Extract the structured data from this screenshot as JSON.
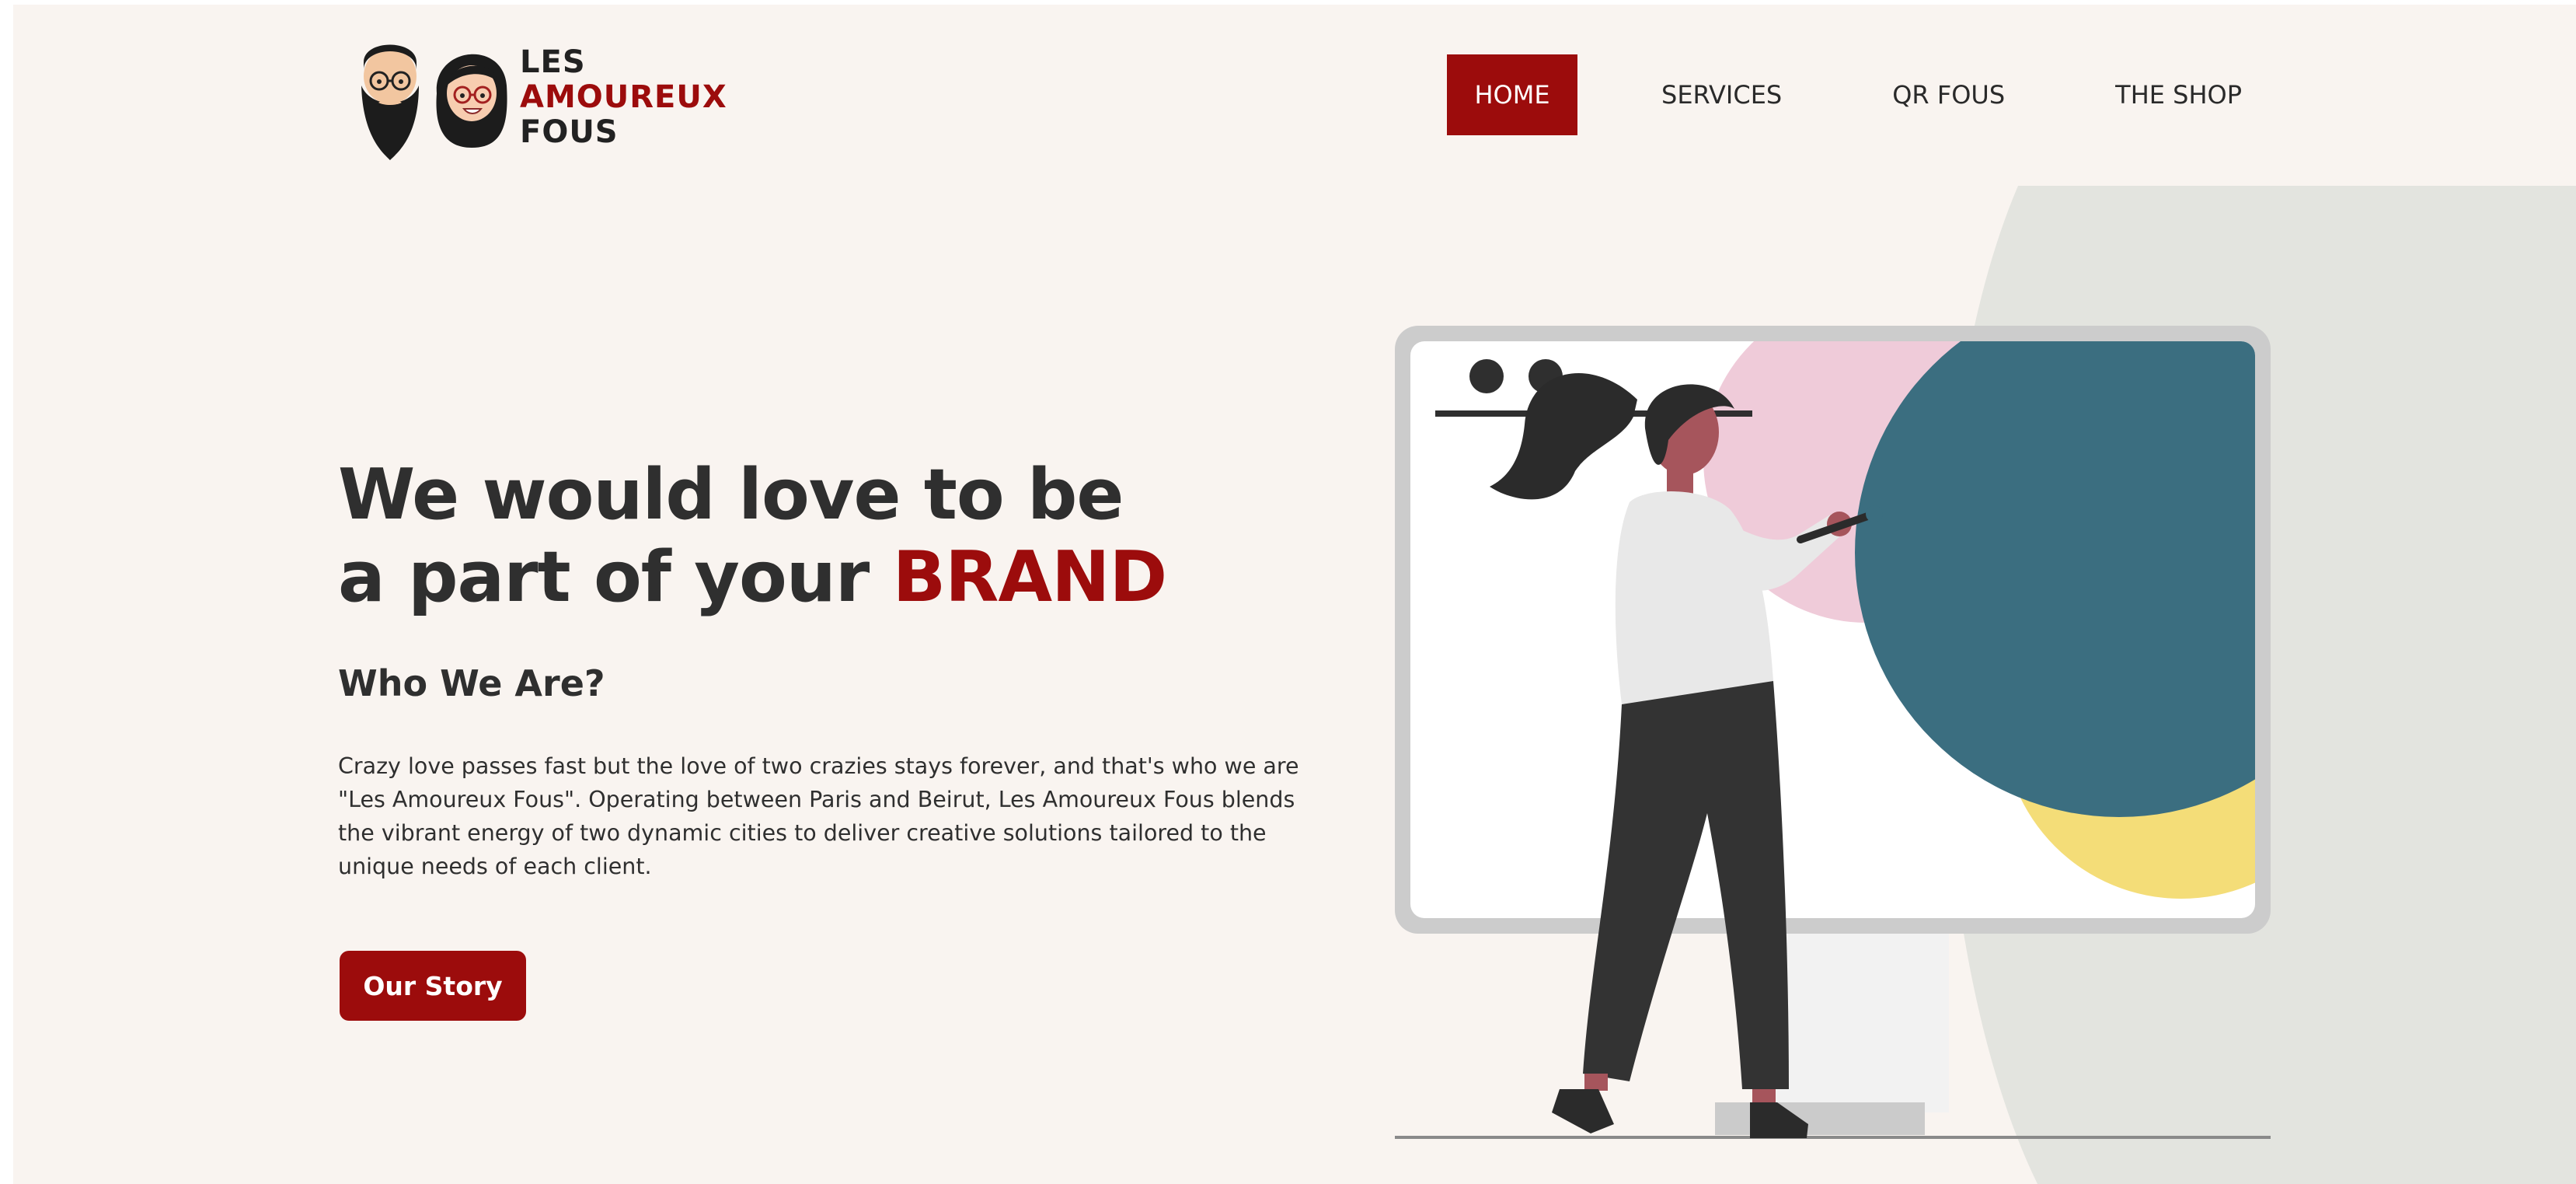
{
  "header": {
    "logo_lines": [
      "LES",
      "AMOUREUX",
      "FOUS"
    ]
  },
  "nav": {
    "items": [
      {
        "label": "HOME",
        "active": true
      },
      {
        "label": "SERVICES",
        "active": false
      },
      {
        "label": "QR FOUS",
        "active": false
      },
      {
        "label": "THE SHOP",
        "active": false
      }
    ]
  },
  "hero": {
    "title_line1": "We would love to be",
    "title_line2_prefix": "a part of your ",
    "title_highlight": "BRAND",
    "subtitle": "Who We Are?",
    "description": "Crazy love passes fast but the love of two crazies stays forever, and that's who we are \"Les Amoureux Fous\". Operating between Paris and Beirut, Les Amoureux Fous blends the vibrant energy of two dynamic cities to deliver creative solutions tailored to the unique needs of each client.",
    "cta_label": "Our Story"
  },
  "colors": {
    "brand_red": "#9c0c0c",
    "background": "#f9f4f0",
    "sage_panel": "#e3e4df",
    "teal": "#3b6e80",
    "pink": "#efcbd9",
    "yellow": "#f4dd78"
  },
  "icons": {
    "logo": "bearded-man-and-woman-avatars"
  }
}
